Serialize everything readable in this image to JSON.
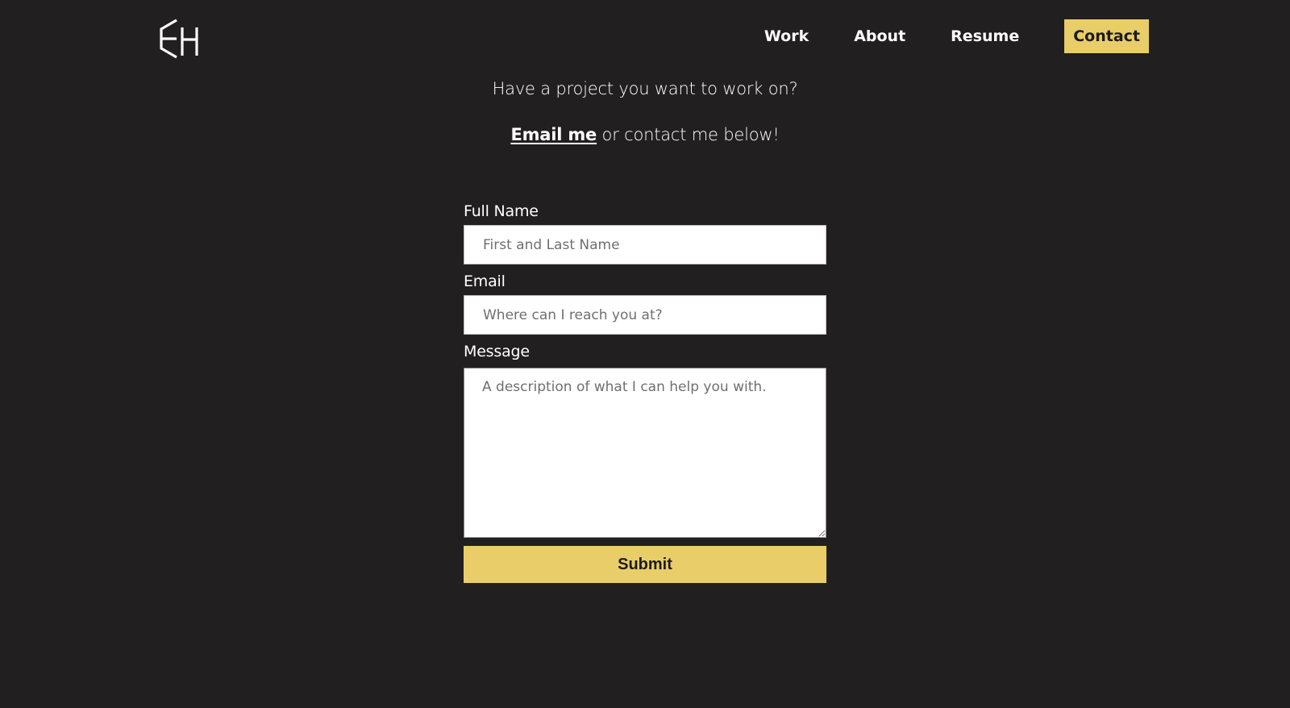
{
  "header": {
    "logo_text": "EH",
    "nav": [
      {
        "label": "Work"
      },
      {
        "label": "About"
      },
      {
        "label": "Resume"
      },
      {
        "label": "Contact",
        "active": true
      }
    ]
  },
  "intro": {
    "line1": "Have a project you want to work on?",
    "email_link": "Email me",
    "line2_rest": " or contact me below!"
  },
  "form": {
    "full_name": {
      "label": "Full Name",
      "placeholder": "First and Last Name",
      "value": ""
    },
    "email": {
      "label": "Email",
      "placeholder": "Where can I reach you at?",
      "value": ""
    },
    "message": {
      "label": "Message",
      "placeholder": "A description of what I can help you with.",
      "value": ""
    },
    "submit_label": "Submit"
  },
  "colors": {
    "background": "#221f21",
    "accent": "#e9cd69",
    "text": "#ffffff",
    "dark_text": "#1d1b1c"
  }
}
